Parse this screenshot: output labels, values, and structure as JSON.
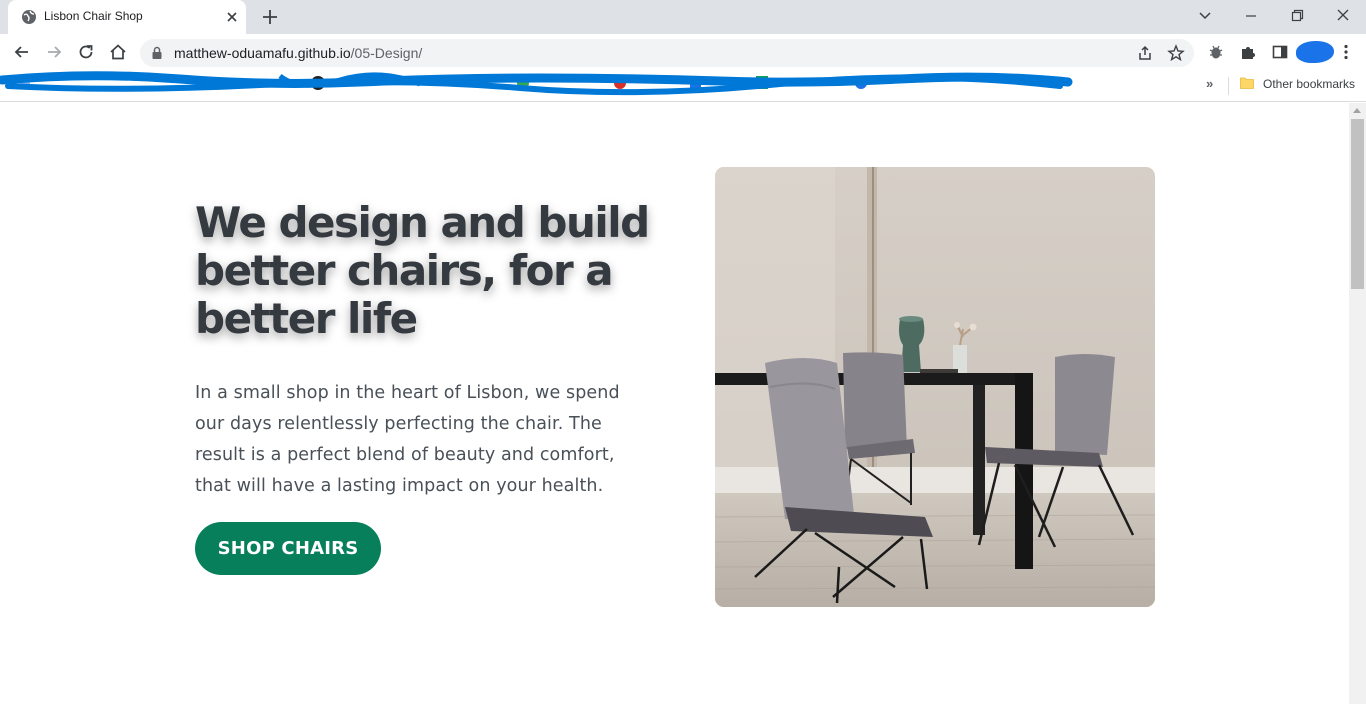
{
  "browser": {
    "tab_title": "Lisbon Chair Shop",
    "url_host": "matthew-oduamafu.github.io",
    "url_path": "/05-Design/",
    "bookmarks_overflow": "»",
    "other_bookmarks_label": "Other bookmarks",
    "profile_color": "#1a73e8"
  },
  "hero": {
    "title": "We design and build better chairs, for a better life",
    "description": "In a small shop in the heart of Lisbon, we spend our days relentlessly perfecting the chair. The result is a perfect blend of beauty and comfort, that will have a lasting impact on your health.",
    "cta_label": "SHOP CHAIRS",
    "image_subject": "dining-table-with-grey-chairs-photo"
  },
  "colors": {
    "accent": "#087f5b",
    "heading": "#343a40",
    "body_text": "#495057"
  }
}
